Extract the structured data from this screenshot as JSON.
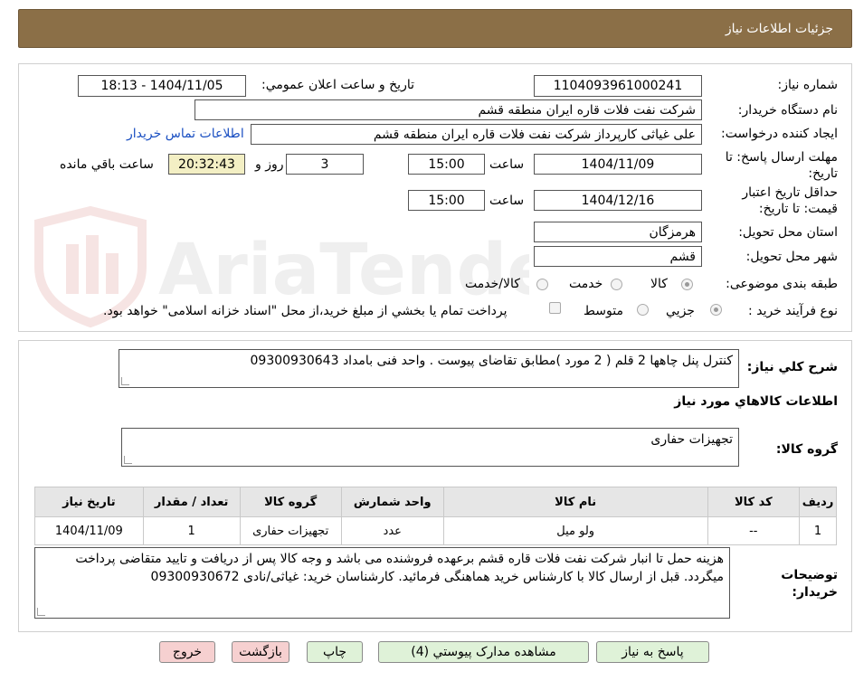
{
  "header": {
    "title": "جزئیات اطلاعات نیاز"
  },
  "form": {
    "need_number": {
      "label": "شماره نیاز:",
      "value": "1104093961000241"
    },
    "announce_datetime": {
      "label": "تاریخ و ساعت اعلان عمومي:",
      "value": "1404/11/05 - 18:13"
    },
    "buyer_org": {
      "label": "نام دستگاه خريدار:",
      "value": "شرکت نفت فلات قاره ایران منطقه قشم"
    },
    "requester": {
      "label": "ايجاد کننده درخواست:",
      "value": "علی غیاثی کارپرداز شرکت نفت فلات قاره ایران منطقه قشم"
    },
    "contact_link": "اطلاعات تماس خريدار",
    "reply_deadline": {
      "label_line1": "مهلت ارسال پاسخ: تا",
      "label_line2": "تاريخ:",
      "date": "1404/11/09",
      "time_label": "ساعت",
      "time": "15:00",
      "days": "3",
      "days_label": "روز و",
      "remaining": "20:32:43",
      "remaining_label": "ساعت باقي مانده"
    },
    "price_validity": {
      "label_line1": "حداقل تاريخ اعتبار",
      "label_line2": "قيمت: تا تاريخ:",
      "date": "1404/12/16",
      "time_label": "ساعت",
      "time": "15:00"
    },
    "province": {
      "label": "استان محل تحويل:",
      "value": "هرمزگان"
    },
    "city": {
      "label": "شهر محل تحويل:",
      "value": "قشم"
    },
    "category": {
      "label": "طبقه بندی موضوعی:",
      "options": [
        "کالا",
        "خدمت",
        "کالا/خدمت"
      ],
      "selected": "کالا"
    },
    "purchase_type": {
      "label": "نوع فرآيند خريد :",
      "options": [
        "جزيي",
        "متوسط"
      ],
      "payment_note": "پرداخت تمام يا بخشي از مبلغ خريد،از محل \"اسناد خزانه اسلامی\" خواهد بود."
    }
  },
  "summary": {
    "label": "شرح كلي نياز:",
    "value": "کنترل پنل چاهها 2 قلم ( 2 مورد )مطابق تقاضای پیوست . واحد فنی بامداد 09300930643"
  },
  "goods_section_title": "اطلاعات كالاهاي مورد نياز",
  "goods_group": {
    "label": "گروه کالا:",
    "value": "تجهیزات حفاری"
  },
  "table": {
    "headers": [
      "رديف",
      "کد کالا",
      "نام کالا",
      "واحد شمارش",
      "گروه کالا",
      "تعداد / مقدار",
      "تاريخ نياز"
    ],
    "rows": [
      [
        "1",
        "--",
        "ولو میل",
        "عدد",
        "تجهیزات حفاری",
        "1",
        "1404/11/09"
      ]
    ]
  },
  "buyer_notes": {
    "label_line1": "توضيحات",
    "label_line2": "خريدار:",
    "value": "هزینه حمل تا انبار شرکت نفت فلات قاره قشم برعهده فروشنده می باشد و وجه کالا پس از دریافت و تایید متقاضی پرداخت میگردد. قبل از ارسال کالا با کارشناس خرید هماهنگی فرمائید. کارشناسان خرید: غیاثی/نادی 09300930672"
  },
  "buttons": {
    "reply": "پاسخ به نياز",
    "attachments": "مشاهده مدارک پيوستي (4)",
    "print": "چاپ",
    "back": "بازگشت",
    "exit": "خروج"
  },
  "watermark": {
    "text": "AriaTender.net"
  },
  "colors": {
    "header_bg": "#8b6f47",
    "link": "#1a4fc2",
    "timer_bg": "#f3efc4",
    "btn_green": "#dff2d8",
    "btn_red": "#f6d0d0"
  }
}
